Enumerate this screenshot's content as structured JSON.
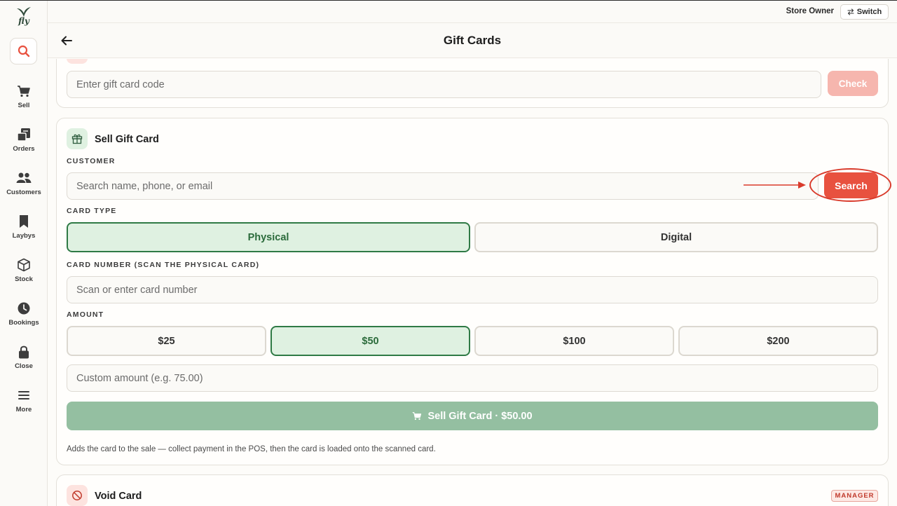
{
  "app": {
    "logo_text": "fly"
  },
  "topbar": {
    "user_role": "Store Owner",
    "switch_label": "Switch"
  },
  "header": {
    "title": "Gift Cards"
  },
  "sidebar": {
    "items": [
      {
        "label": "Sell",
        "icon": "cart-icon"
      },
      {
        "label": "Orders",
        "icon": "orders-icon"
      },
      {
        "label": "Customers",
        "icon": "customers-icon"
      },
      {
        "label": "Laybys",
        "icon": "bookmark-icon"
      },
      {
        "label": "Stock",
        "icon": "box-icon"
      },
      {
        "label": "Bookings",
        "icon": "clock-icon"
      },
      {
        "label": "Close",
        "icon": "lock-icon"
      },
      {
        "label": "More",
        "icon": "menu-icon"
      }
    ]
  },
  "check_card": {
    "code_placeholder": "Enter gift card code",
    "check_label": "Check"
  },
  "sell_card": {
    "title": "Sell Gift Card",
    "customer_label": "CUSTOMER",
    "customer_placeholder": "Search name, phone, or email",
    "search_label": "Search",
    "card_type_label": "CARD TYPE",
    "card_types": [
      "Physical",
      "Digital"
    ],
    "selected_card_type": "Physical",
    "card_number_label": "CARD NUMBER (SCAN THE PHYSICAL CARD)",
    "card_number_placeholder": "Scan or enter card number",
    "amount_label": "AMOUNT",
    "amounts": [
      "$25",
      "$50",
      "$100",
      "$200"
    ],
    "selected_amount": "$50",
    "custom_amount_placeholder": "Custom amount (e.g. 75.00)",
    "submit_label": "Sell Gift Card · $50.00",
    "help_text": "Adds the card to the sale — collect payment in the POS, then the card is loaded onto the scanned card."
  },
  "void_card": {
    "title": "Void Card",
    "badge": "MANAGER"
  },
  "colors": {
    "accent_red": "#e8513f",
    "check_disabled": "#f6b6ae",
    "selected_green": "#2f7a45",
    "submit_green": "#94bfa1"
  }
}
